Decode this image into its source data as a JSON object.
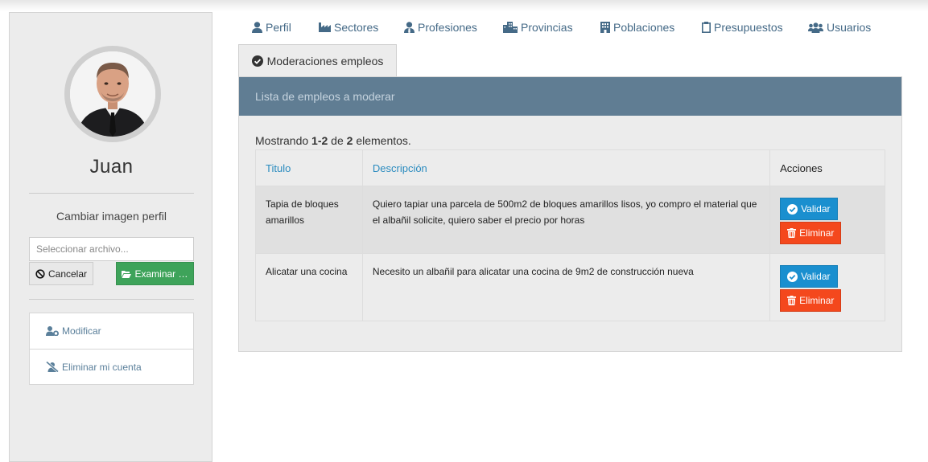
{
  "sidebar": {
    "user_name": "Juan",
    "change_image_label": "Cambiar imagen perfil",
    "file_input_placeholder": "Seleccionar archivo...",
    "cancel_label": "Cancelar",
    "browse_label": "Examinar …",
    "menu": [
      {
        "label": "Modificar",
        "icon": "user-cog-icon"
      },
      {
        "label": "Eliminar mi cuenta",
        "icon": "user-slash-icon"
      }
    ]
  },
  "tabs": [
    {
      "label": "Perfil",
      "icon": "user-icon"
    },
    {
      "label": "Sectores",
      "icon": "industry-icon"
    },
    {
      "label": "Profesiones",
      "icon": "user-tie-icon"
    },
    {
      "label": "Provincias",
      "icon": "city-icon"
    },
    {
      "label": "Poblaciones",
      "icon": "building-icon"
    },
    {
      "label": "Presupuestos",
      "icon": "clipboard-icon"
    },
    {
      "label": "Usuarios",
      "icon": "users-icon"
    },
    {
      "label": "Moderaciones empleos",
      "icon": "check-circle-icon",
      "active": true
    }
  ],
  "panel": {
    "title": "Lista de empleos a moderar",
    "summary_prefix": "Mostrando ",
    "summary_range": "1-2",
    "summary_mid": " de ",
    "summary_total": "2",
    "summary_suffix": " elementos."
  },
  "table": {
    "columns": [
      "Titulo",
      "Descripción",
      "Acciones"
    ],
    "rows": [
      {
        "titulo": "Tapia de bloques amarillos",
        "descripcion": "Quiero tapiar una parcela de 500m2 de bloques amarillos lisos, yo compro el material que el albañil solicite, quiero saber el precio por horas"
      },
      {
        "titulo": "Alicatar una cocina",
        "descripcion": "Necesito un albañil para alicatar una cocina de 9m2 de construcción nueva"
      }
    ],
    "validate_label": "Validar",
    "delete_label": "Eliminar"
  },
  "colors": {
    "panel_header": "#607d93",
    "validate": "#1a8fcf",
    "delete": "#f4481d",
    "browse": "#3ea35a",
    "link": "#456a87"
  }
}
